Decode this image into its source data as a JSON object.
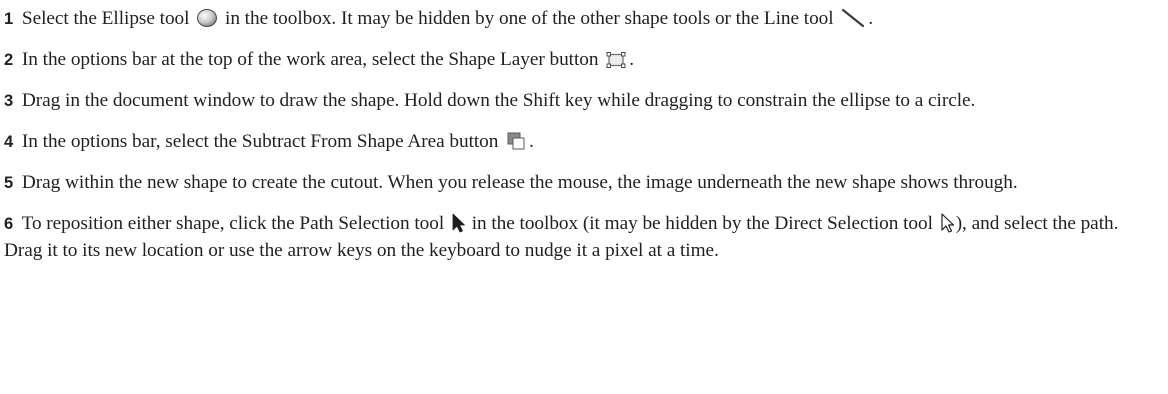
{
  "steps": [
    {
      "number": "1",
      "parts": [
        "Select the Ellipse tool",
        "in the toolbox. It may be hidden by one of the other shape tools or the Line tool",
        "."
      ],
      "icons": [
        "ellipse-tool-icon",
        "line-tool-icon"
      ]
    },
    {
      "number": "2",
      "parts": [
        "In the options bar at the top of the work area, select the Shape Layer button",
        "."
      ],
      "icons": [
        "shape-layer-button-icon"
      ]
    },
    {
      "number": "3",
      "text": "Drag in the document window to draw the shape. Hold down the Shift key while dragging to constrain the ellipse to a circle."
    },
    {
      "number": "4",
      "parts": [
        "In the options bar, select the Subtract From Shape Area button",
        "."
      ],
      "icons": [
        "subtract-from-shape-area-icon"
      ]
    },
    {
      "number": "5",
      "text": "Drag within the new shape to create the cutout. When you release the mouse, the image underneath the new shape shows through."
    },
    {
      "number": "6",
      "parts": [
        "To reposition either shape, click the Path Selection tool",
        "in the toolbox (it may be hidden by the Direct Selection tool",
        "), and select the path. Drag it to its new location or use the arrow keys on the keyboard to nudge it a pixel at a time."
      ],
      "icons": [
        "path-selection-tool-icon",
        "direct-selection-tool-icon"
      ]
    }
  ]
}
